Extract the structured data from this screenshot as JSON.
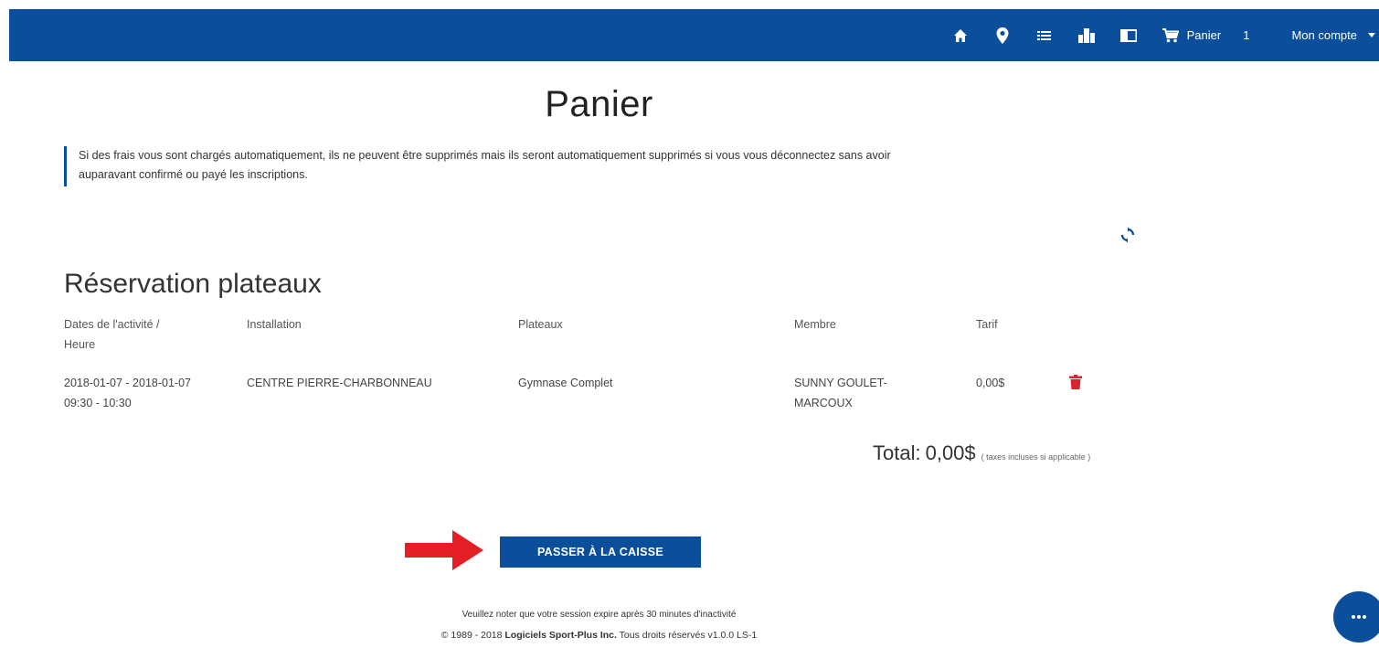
{
  "navbar": {
    "icons": [
      "home-icon",
      "location-icon",
      "list-icon",
      "buildings-icon",
      "card-icon",
      "cart-icon"
    ],
    "cart_label": "Panier",
    "cart_count": "1",
    "account_label": "Mon compte",
    "color": "#0b4f9c"
  },
  "page_title": "Panier",
  "notice": {
    "line1": "Si des frais vous sont chargés automatiquement, ils ne peuvent être supprimés mais ils seront automatiquement supprimés si vous vous déconnectez sans avoir",
    "line2": "auparavant confirmé ou payé les inscriptions."
  },
  "section_title": "Réservation plateaux",
  "table": {
    "headers": {
      "dates_line1": "Dates de l'activité /",
      "dates_line2": "Heure",
      "installation": "Installation",
      "plateaux": "Plateaux",
      "membre": "Membre",
      "tarif": "Tarif"
    },
    "rows": [
      {
        "dates_line1": "2018-01-07 - 2018-01-07",
        "dates_line2": "09:30 - 10:30",
        "installation": "CENTRE PIERRE-CHARBONNEAU",
        "plateaux": "Gymnase Complet",
        "membre_line1": "SUNNY GOULET-",
        "membre_line2": "MARCOUX",
        "tarif": "0,00$"
      }
    ]
  },
  "total": {
    "label": "Total:",
    "value": "0,00$",
    "note": "( taxes incluses si applicable )"
  },
  "checkout_button": "PASSER À LA CAISSE",
  "footer": {
    "session_note": "Veuillez noter que votre session expire après 30 minutes d'inactivité",
    "copyright_prefix": "© 1989 - 2018",
    "company": "Logiciels Sport-Plus Inc.",
    "copyright_suffix": "Tous droits réservés v1.0.0 LS-1"
  },
  "colors": {
    "primary": "#0b4f9c",
    "delete": "#d9232d",
    "arrow": "#e31e24"
  }
}
